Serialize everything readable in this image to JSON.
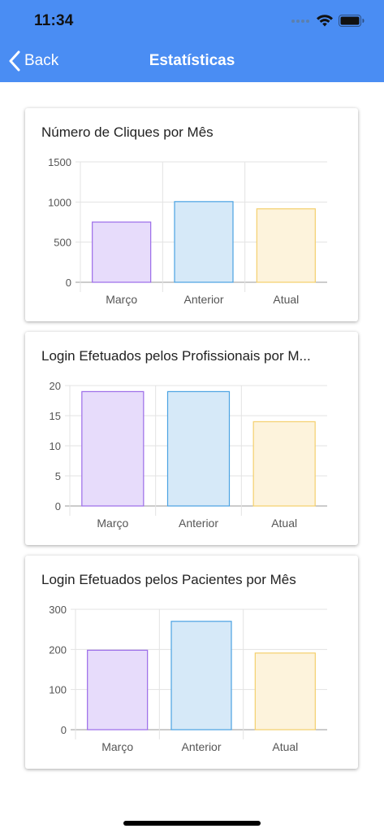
{
  "status_bar": {
    "time": "11:34",
    "icons": [
      "signal-icon",
      "wifi-icon",
      "battery-icon"
    ]
  },
  "nav": {
    "back_label": "Back",
    "title": "Estatísticas",
    "back_icon": "chevron-left-icon"
  },
  "colors": {
    "header_bg": "#4a8df3",
    "series_fill": [
      "#e7dcfb",
      "#d6e9f8",
      "#fdf3dc"
    ],
    "series_stroke": [
      "#9b6be8",
      "#4aa2e2",
      "#f4cf6c"
    ]
  },
  "chart_data": [
    {
      "type": "bar",
      "title": "Número de Cliques por Mês",
      "categories": [
        "Março",
        "Anterior",
        "Atual"
      ],
      "values": [
        750,
        1005,
        915
      ],
      "ylim": [
        0,
        1500
      ],
      "yticks": [
        0,
        500,
        1000,
        1500
      ],
      "grid": true
    },
    {
      "type": "bar",
      "title": "Login Efetuados pelos Profissionais por M...",
      "categories": [
        "Março",
        "Anterior",
        "Atual"
      ],
      "values": [
        19,
        19,
        14
      ],
      "ylim": [
        0,
        20
      ],
      "yticks": [
        0,
        5,
        10,
        15,
        20
      ],
      "grid": true
    },
    {
      "type": "bar",
      "title": "Login Efetuados pelos Pacientes por Mês",
      "categories": [
        "Março",
        "Anterior",
        "Atual"
      ],
      "values": [
        198,
        270,
        191
      ],
      "ylim": [
        0,
        300
      ],
      "yticks": [
        0,
        100,
        200,
        300
      ],
      "grid": true
    }
  ]
}
